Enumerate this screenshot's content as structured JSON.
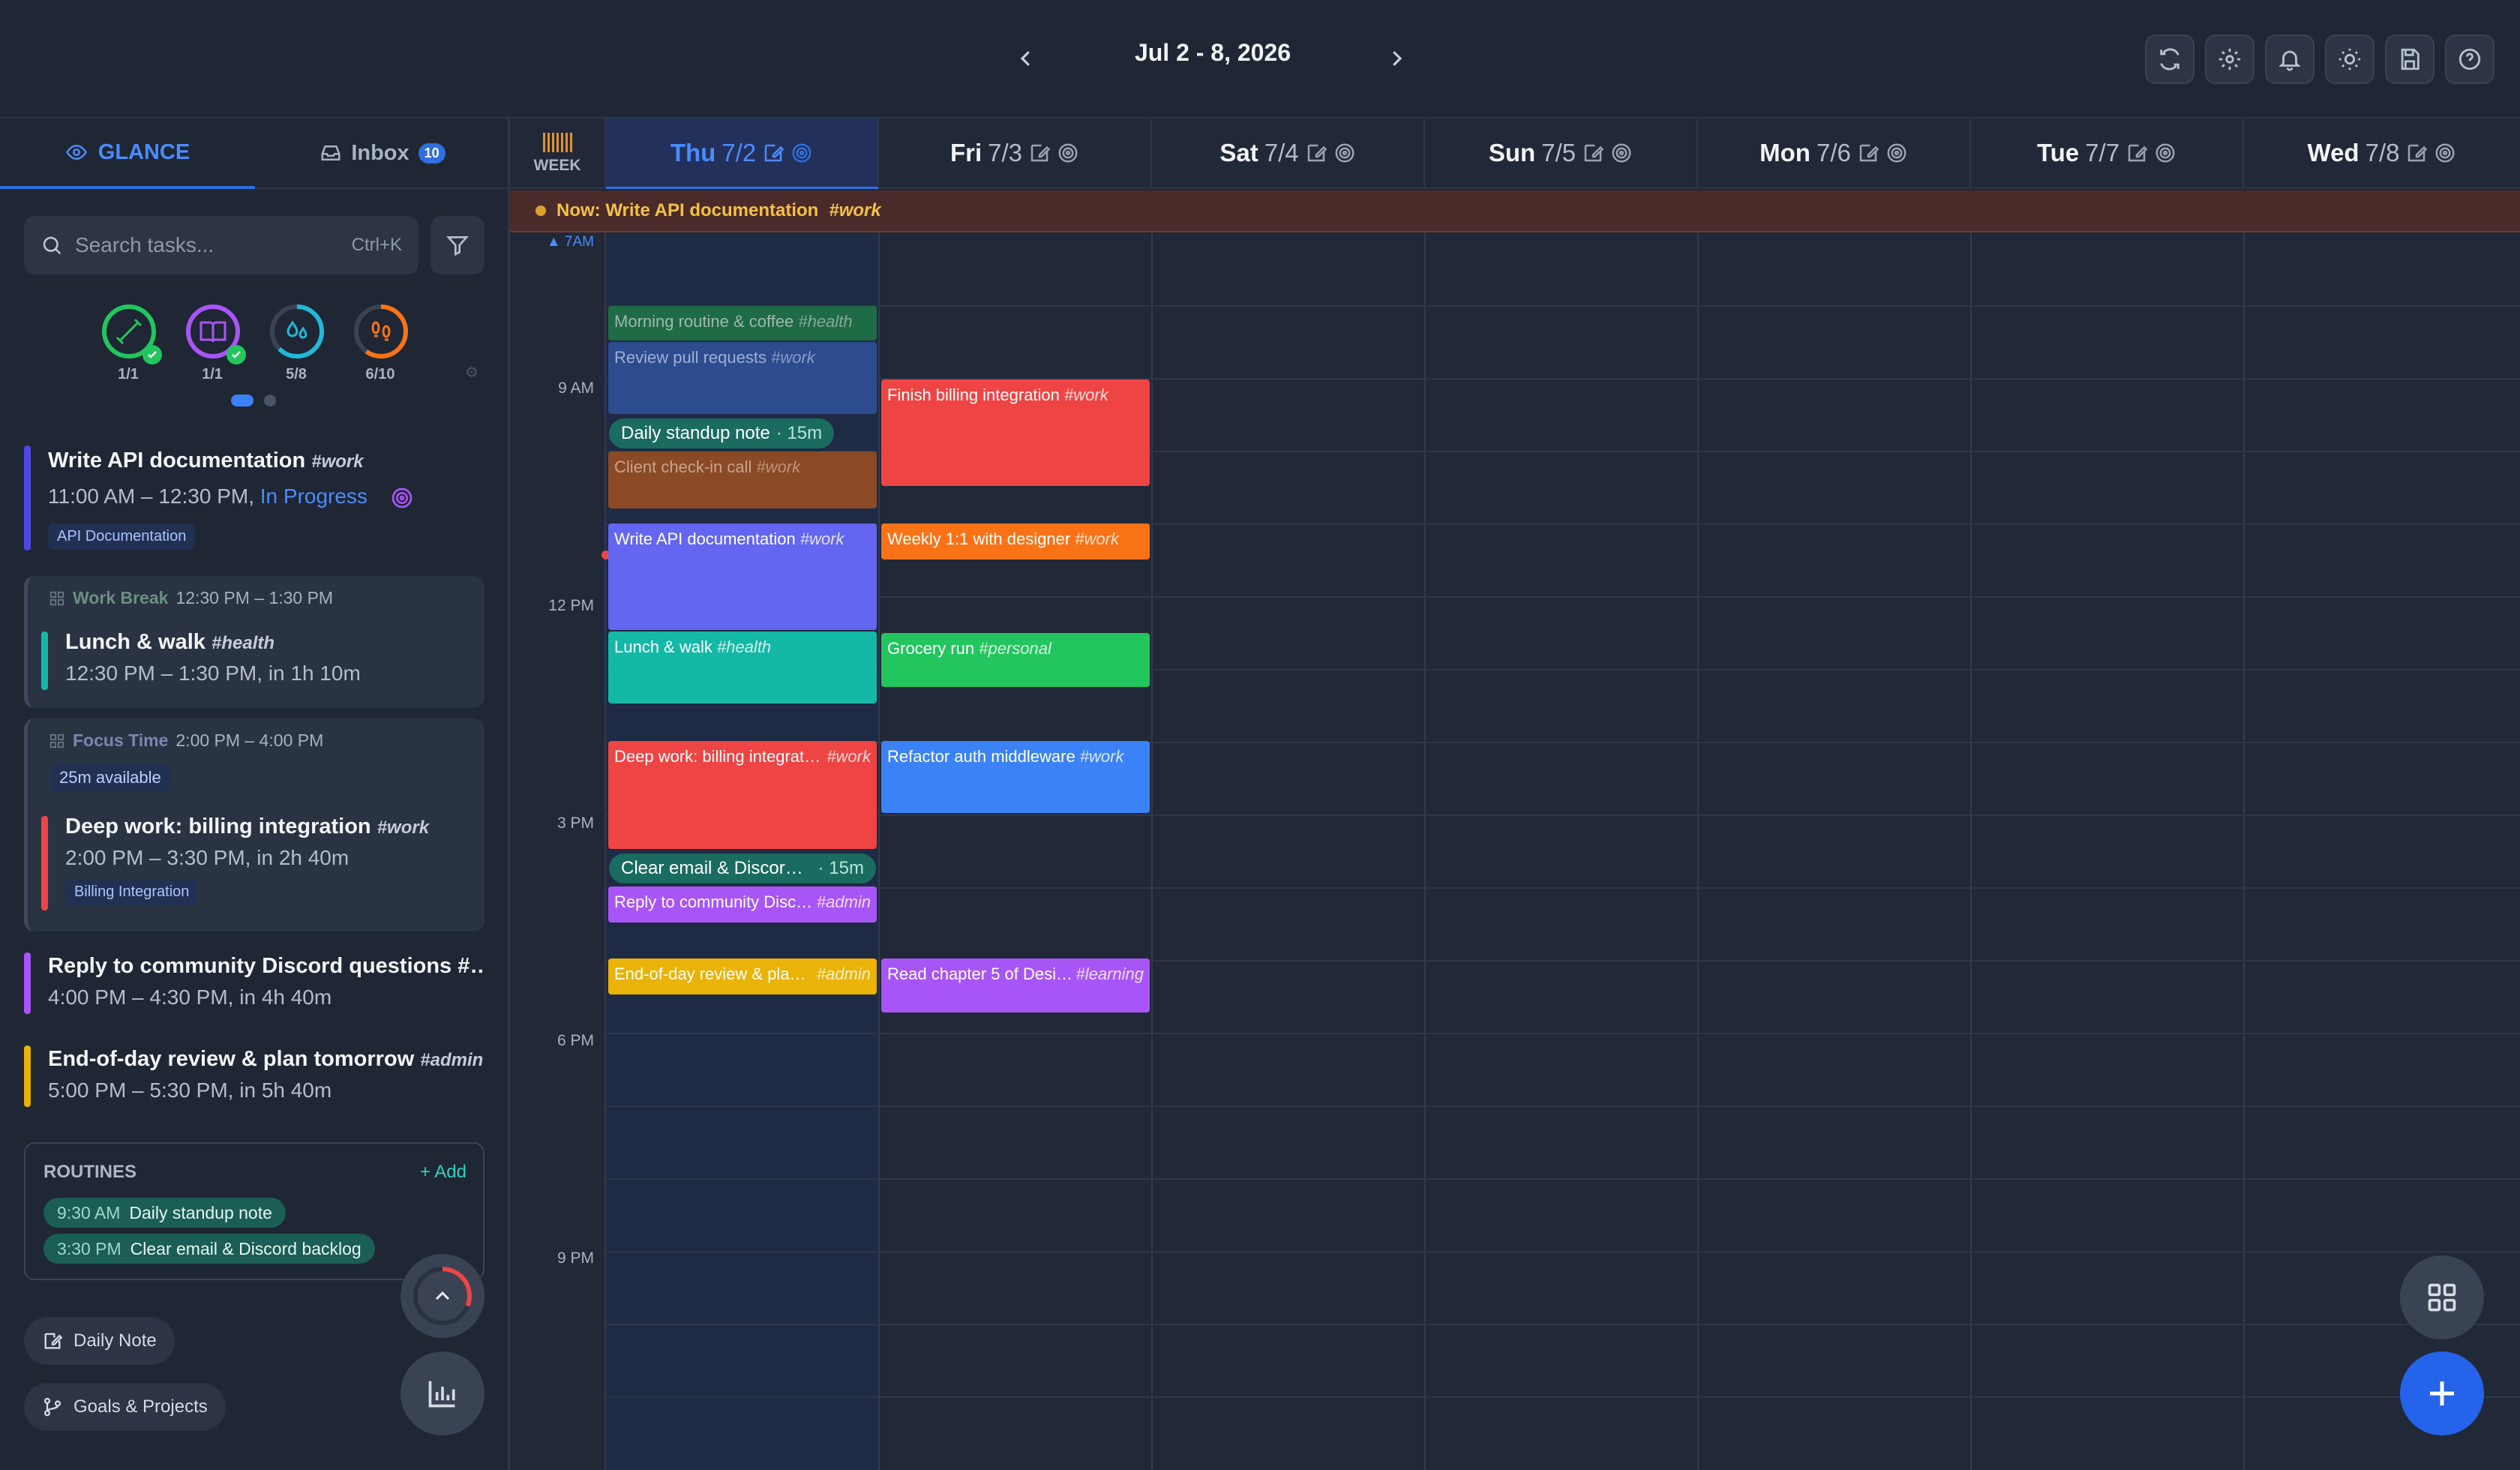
{
  "header": {
    "week_range": "Jul 2 - 8, 2026"
  },
  "sidebar": {
    "tabs": {
      "glance": "GLANCE",
      "inbox": "Inbox",
      "inbox_count": "10"
    },
    "search": {
      "placeholder": "Search tasks...",
      "shortcut": "Ctrl+K"
    },
    "habits": [
      {
        "icon": "dumbbell-icon",
        "label": "1/1",
        "color": "#22c55e",
        "progress": 1.0
      },
      {
        "icon": "book-icon",
        "label": "1/1",
        "color": "#a855f7",
        "progress": 1.0
      },
      {
        "icon": "water-icon",
        "label": "5/8",
        "color": "#22b8d8",
        "progress": 0.625
      },
      {
        "icon": "footsteps-icon",
        "label": "6/10",
        "color": "#f97316",
        "progress": 0.6
      }
    ],
    "tasks": {
      "t1": {
        "title": "Write API documentation",
        "tag": "#work",
        "time": "11:00 AM – 12:30 PM,",
        "status": "In Progress",
        "project": "API Documentation"
      },
      "g1": {
        "label": "Work Break",
        "range": "12:30 PM – 1:30 PM"
      },
      "t2": {
        "title": "Lunch & walk",
        "tag": "#health",
        "time": "12:30 PM – 1:30 PM, in 1h 10m"
      },
      "g2": {
        "label": "Focus Time",
        "range": "2:00 PM – 4:00 PM",
        "available": "25m available"
      },
      "t3": {
        "title": "Deep work: billing integration",
        "tag": "#work",
        "time": "2:00 PM – 3:30 PM, in 2h 40m",
        "project": "Billing Integration"
      },
      "t4": {
        "title": "Reply to community Discord questions #…",
        "time": "4:00 PM – 4:30 PM, in 4h 40m"
      },
      "t5": {
        "title": "End-of-day review & plan tomorrow",
        "tag": "#admin",
        "time": "5:00 PM – 5:30 PM, in 5h 40m"
      }
    },
    "routines": {
      "title": "ROUTINES",
      "add": "+ Add",
      "r1": {
        "time": "9:30 AM",
        "name": "Daily standup note"
      },
      "r2": {
        "time": "3:30 PM",
        "name": "Clear email & Discord backlog"
      }
    },
    "buttons": {
      "daily_note": "Daily Note",
      "goals": "Goals & Projects"
    }
  },
  "calendar": {
    "week_tag": "WEEK",
    "days": [
      {
        "name": "Thu",
        "date": "7/2"
      },
      {
        "name": "Fri",
        "date": "7/3"
      },
      {
        "name": "Sat",
        "date": "7/4"
      },
      {
        "name": "Sun",
        "date": "7/5"
      },
      {
        "name": "Mon",
        "date": "7/6"
      },
      {
        "name": "Tue",
        "date": "7/7"
      },
      {
        "name": "Wed",
        "date": "7/8"
      }
    ],
    "now_banner": {
      "prefix": "Now: Write API documentation",
      "tag": "#work"
    },
    "hours": {
      "h7": "▲ 7AM",
      "h9": "9 AM",
      "h12": "12 PM",
      "h15": "3 PM",
      "h18": "6 PM",
      "h21": "9 PM"
    },
    "events": {
      "e1": {
        "title": "Morning routine & coffee",
        "tag": "#health"
      },
      "e2": {
        "title": "Review pull requests",
        "tag": "#work"
      },
      "e3": {
        "title": "Daily standup note",
        "dur": "· 15m"
      },
      "e4": {
        "title": "Client check-in call",
        "tag": "#work"
      },
      "e5": {
        "title": "Write API documentation",
        "tag": "#work"
      },
      "e6": {
        "title": "Lunch & walk",
        "tag": "#health"
      },
      "e7": {
        "title": "Deep work: billing integrat…",
        "tag": "#work"
      },
      "e8": {
        "title": "Clear email & Discord…",
        "dur": "· 15m"
      },
      "e9": {
        "title": "Reply to community Disc…",
        "tag": "#admin"
      },
      "e10": {
        "title": "End-of-day review & pla…",
        "tag": "#admin"
      },
      "f1": {
        "title": "Finish billing integration",
        "tag": "#work"
      },
      "f2": {
        "title": "Weekly 1:1 with designer",
        "tag": "#work"
      },
      "f3": {
        "title": "Grocery run",
        "tag": "#personal"
      },
      "f4": {
        "title": "Refactor auth middleware",
        "tag": "#work"
      },
      "f5": {
        "title": "Read chapter 5 of Desi…",
        "tag": "#learning"
      }
    }
  },
  "colors": {
    "accent": "#2f6fe0",
    "now": "#f5c143"
  }
}
